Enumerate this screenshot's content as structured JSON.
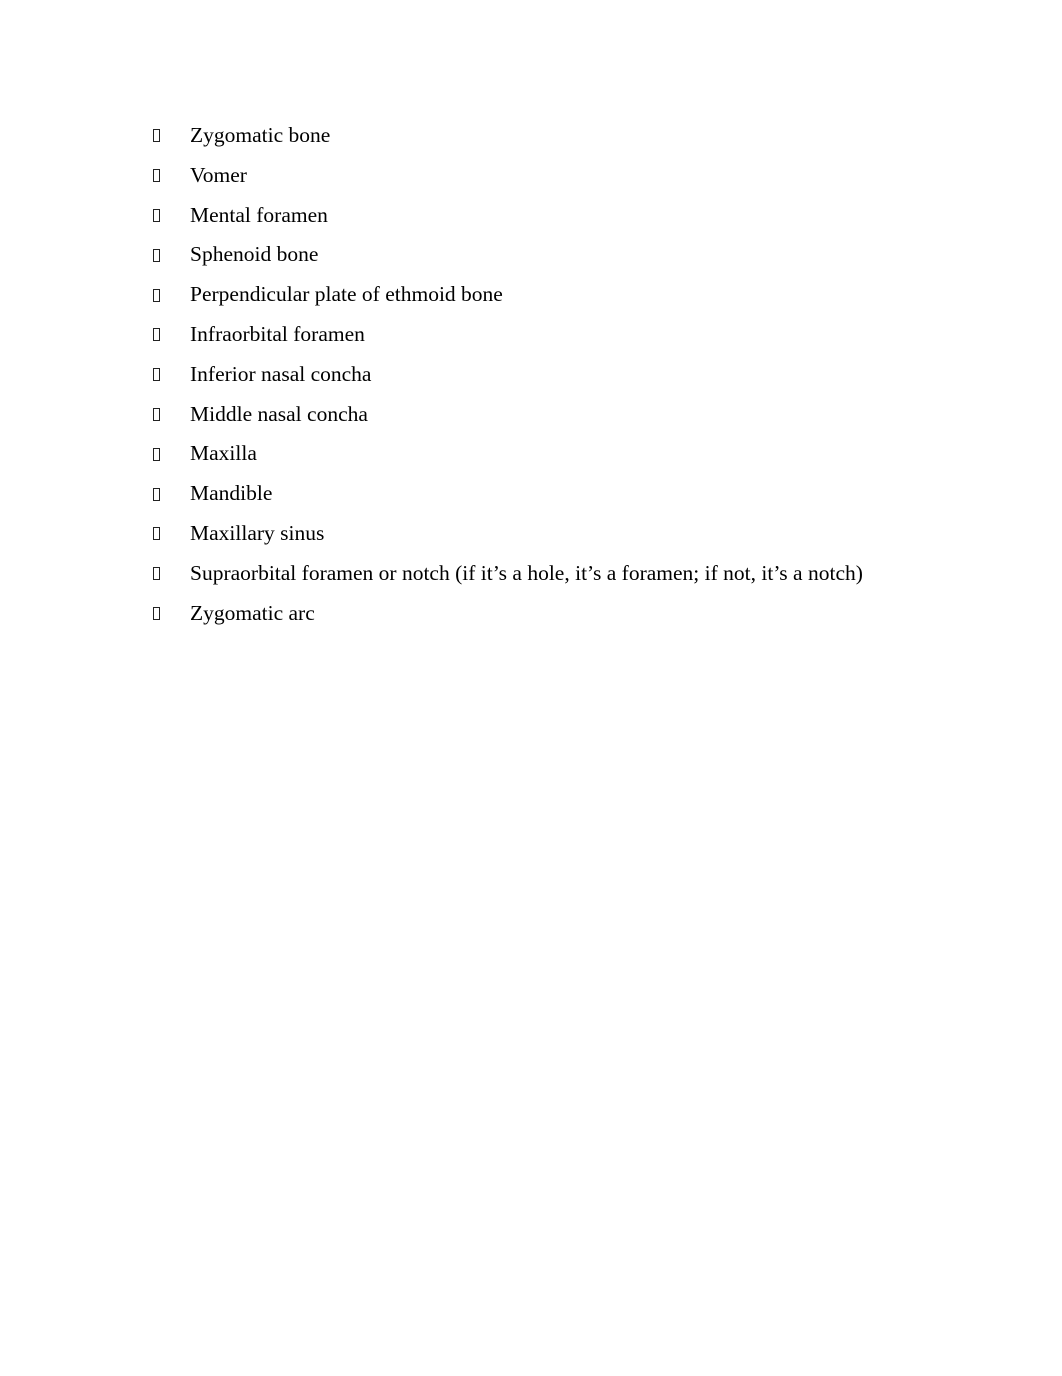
{
  "document": {
    "background_color": "#ffffff",
    "text_color": "#000000",
    "list": {
      "marker_glyph_name": "missing-glyph-box",
      "items": [
        {
          "text": "Zygomatic bone"
        },
        {
          "text": "Vomer"
        },
        {
          "text": "Mental foramen"
        },
        {
          "text": "Sphenoid bone"
        },
        {
          "text": "Perpendicular plate of ethmoid bone"
        },
        {
          "text": "Infraorbital foramen"
        },
        {
          "text": "Inferior nasal concha"
        },
        {
          "text": "Middle nasal concha"
        },
        {
          "text": "Maxilla"
        },
        {
          "text": "Mandible"
        },
        {
          "text": "Maxillary sinus"
        },
        {
          "text": "Supraorbital foramen or notch (if it’s a hole, it’s a foramen; if not, it’s a notch)"
        },
        {
          "text": "Zygomatic arc"
        }
      ]
    }
  }
}
